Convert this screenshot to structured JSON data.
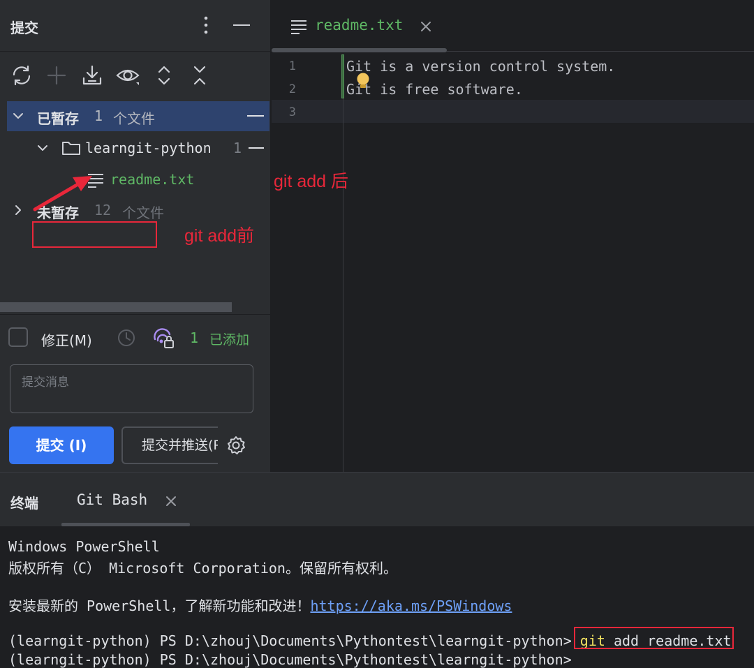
{
  "commit_panel": {
    "title": "提交",
    "staged": {
      "label": "已暂存",
      "count": "1",
      "unit": "个文件"
    },
    "folder": {
      "name": "learngit-python",
      "count": "1"
    },
    "file": {
      "name": "readme.txt"
    },
    "unstaged": {
      "label": "未暂存",
      "count": "12",
      "unit": "个文件"
    },
    "amend_label": "修正(M)",
    "added_count": "1",
    "added_label": "已添加",
    "message_placeholder": "提交消息",
    "commit_button": "提交 (I)",
    "commit_push_button": "提交并推送(P)...",
    "toolbar_icons": [
      "refresh-icon",
      "add-icon",
      "download-icon",
      "eye-icon",
      "expand-icon",
      "collapse-icon"
    ]
  },
  "editor": {
    "tab_label": "readme.txt",
    "line_numbers": [
      "1",
      "2",
      "3"
    ],
    "lines": [
      "Git is a version control system.",
      "Git is free software.",
      ""
    ]
  },
  "terminal": {
    "title": "终端",
    "tab_label": "Git Bash",
    "line1": "Windows PowerShell",
    "line2": "版权所有（C） Microsoft Corporation。保留所有权利。",
    "line3_prefix": "安装最新的 PowerShell，了解新功能和改进！",
    "line3_link": "https://aka.ms/PSWindows",
    "prompt": "(learngit-python) PS D:\\zhouj\\Documents\\Pythontest\\learngit-python> ",
    "cmd_git": "git",
    "cmd_rest": " add readme.txt",
    "line5": "(learngit-python) PS D:\\zhouj\\Documents\\Pythontest\\learngit-python> "
  },
  "annotations": {
    "after_label": "git add 后",
    "before_label": "git add前"
  },
  "colors": {
    "accent_blue": "#3574f0",
    "added_green": "#5fb865",
    "annotation_red": "#e8273a",
    "selection": "#2e436e"
  }
}
